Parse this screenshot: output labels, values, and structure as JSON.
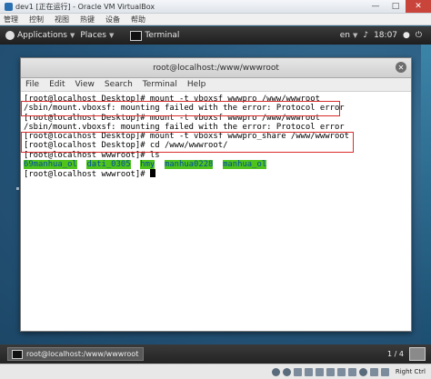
{
  "vbox": {
    "title": "dev1 [正在运行] - Oracle VM VirtualBox",
    "menu": [
      "管理",
      "控制",
      "视图",
      "热键",
      "设备",
      "帮助"
    ],
    "host_key": "Right Ctrl"
  },
  "panel": {
    "applications": "Applications",
    "places": "Places",
    "terminal": "Terminal",
    "language": "en",
    "time": "18:07"
  },
  "terminal": {
    "title": "root@localhost:/www/wwwroot",
    "menu": [
      "File",
      "Edit",
      "View",
      "Search",
      "Terminal",
      "Help"
    ],
    "lines": [
      "[root@localhost Desktop]# mount -t vboxsf wwwpro /www/wwwroot",
      "/sbin/mount.vboxsf: mounting failed with the error: Protocol error",
      "[root@localhost Desktop]# mount -t vboxsf wwwpro /www/wwwroot",
      "/sbin/mount.vboxsf: mounting failed with the error: Protocol error",
      "[root@localhost Desktop]# mount -t vboxsf wwwpro_share /www/wwwroot",
      "[root@localhost Desktop]# cd /www/wwwroot/",
      "[root@localhost wwwroot]# ls"
    ],
    "ls_output": [
      "69manhua_ol",
      "dati_0305",
      "hmy",
      "manhua0228",
      "manhua_ol"
    ],
    "prompt": "[root@localhost wwwroot]# "
  },
  "taskbar": {
    "window": "root@localhost:/www/wwwroot",
    "workspace": "1 / 4"
  }
}
